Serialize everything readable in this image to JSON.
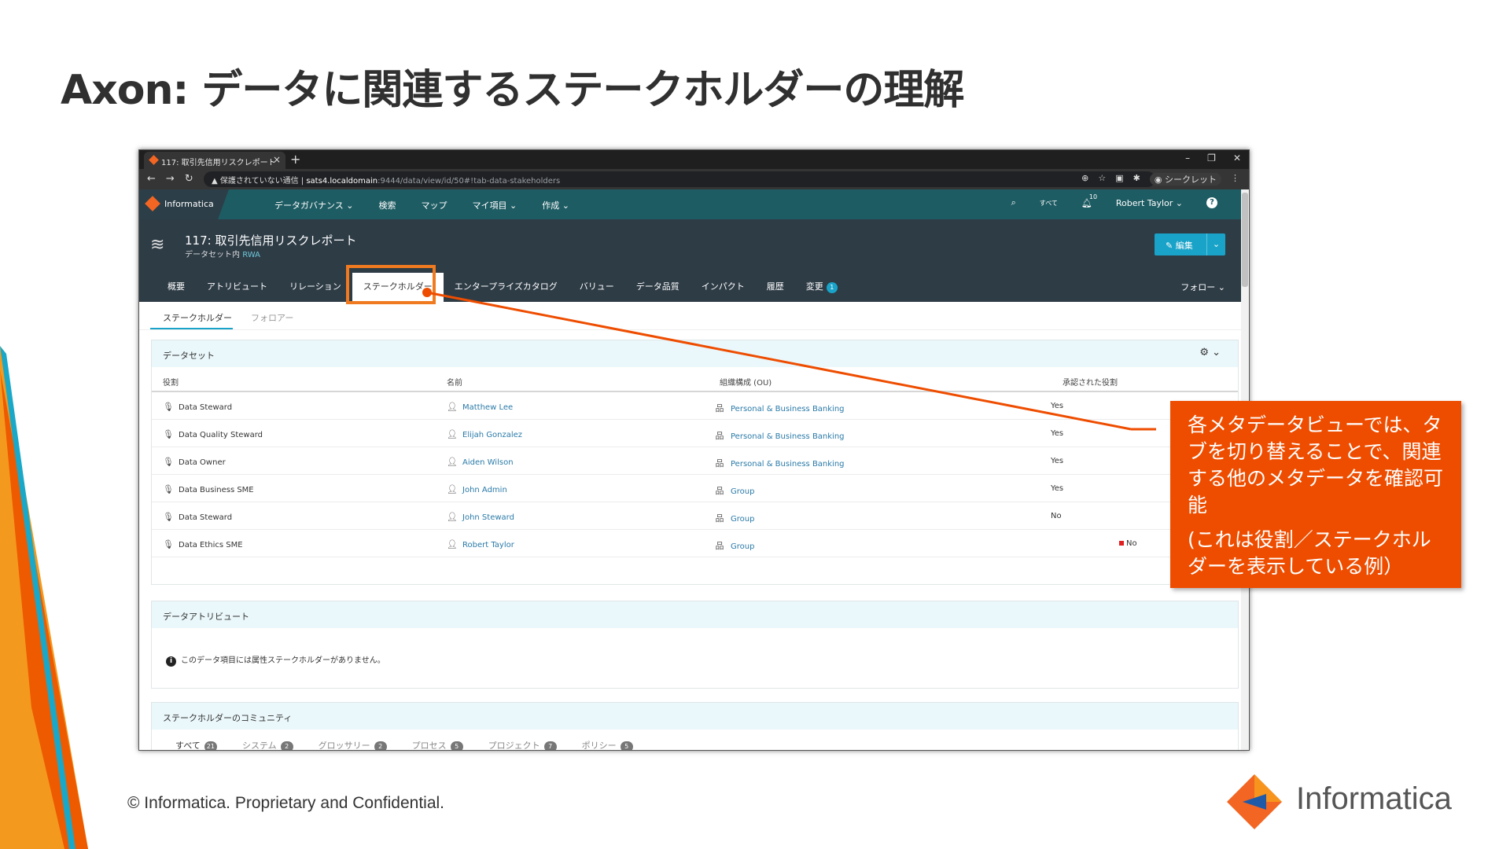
{
  "slide": {
    "title": "Axon: データに関連するステークホルダーの理解",
    "copyright": "© Informatica. Proprietary and Confidential.",
    "logo_text": "Informatica"
  },
  "browser": {
    "tab_title": "117: 取引先信用リスクレポート",
    "new_tab": "+",
    "insecure_label": "保護されていない通信",
    "url_host": "sats4.localdomain",
    "url_path": ":9444/data/view/id/50#!tab-data-stakeholders",
    "incognito_label": "シークレット"
  },
  "app_nav": {
    "logo": "Informatica",
    "items": [
      {
        "label": "データガバナンス ⌄"
      },
      {
        "label": "検索"
      },
      {
        "label": "マップ"
      },
      {
        "label": "マイ項目 ⌄"
      },
      {
        "label": "作成 ⌄"
      }
    ],
    "all_label": "すべて",
    "notification_count": "10",
    "user": "Robert Taylor ⌄"
  },
  "asset": {
    "title": "117: 取引先信用リスクレポート",
    "subtitle_prefix": "データセット内",
    "subtitle_link": "RWA",
    "edit_label": "編集",
    "tabs": [
      {
        "label": "概要"
      },
      {
        "label": "アトリビュート"
      },
      {
        "label": "リレーション"
      },
      {
        "label": "ステークホルダー"
      },
      {
        "label": "エンタープライズカタログ"
      },
      {
        "label": "バリュー"
      },
      {
        "label": "データ品質"
      },
      {
        "label": "インパクト"
      },
      {
        "label": "履歴"
      },
      {
        "label": "変更"
      }
    ],
    "change_count": "1",
    "follow_label": "フォロー ⌄"
  },
  "sub_tabs": {
    "stakeholders": "ステークホルダー",
    "followers": "フォロアー"
  },
  "dataset_panel": {
    "title": "データセット",
    "columns": [
      "役割",
      "名前",
      "組織構成 (OU)",
      "承認された役割"
    ],
    "rows": [
      {
        "role": "Data Steward",
        "name": "Matthew Lee",
        "ou": "Personal & Business Banking",
        "approved": "Yes",
        "flag": false
      },
      {
        "role": "Data Quality Steward",
        "name": "Elijah Gonzalez",
        "ou": "Personal & Business Banking",
        "approved": "Yes",
        "flag": false
      },
      {
        "role": "Data Owner",
        "name": "Aiden Wilson",
        "ou": "Personal & Business Banking",
        "approved": "Yes",
        "flag": false
      },
      {
        "role": "Data Business SME",
        "name": "John Admin",
        "ou": "Group",
        "approved": "Yes",
        "flag": false
      },
      {
        "role": "Data Steward",
        "name": "John Steward",
        "ou": "Group",
        "approved": "No",
        "flag": false
      },
      {
        "role": "Data Ethics SME",
        "name": "Robert Taylor",
        "ou": "Group",
        "approved": "No",
        "flag": true
      }
    ]
  },
  "attribute_panel": {
    "title": "データアトリビュート",
    "info": "このデータ項目には属性ステークホルダーがありません。"
  },
  "community_panel": {
    "title": "ステークホルダーのコミュニティ",
    "tabs": [
      {
        "label": "すべて",
        "count": "21"
      },
      {
        "label": "システム",
        "count": "2"
      },
      {
        "label": "グロッサリー",
        "count": "2"
      },
      {
        "label": "プロセス",
        "count": "5"
      },
      {
        "label": "プロジェクト",
        "count": "7"
      },
      {
        "label": "ポリシー",
        "count": "5"
      }
    ]
  },
  "callout": {
    "line1": "各メタデータビューでは、タブを切り替えることで、関連する他のメタデータを確認可能",
    "line2": "(これは役割／ステークホルダーを表示している例）"
  },
  "colors": {
    "accent_orange": "#f07a1f",
    "callout_bg": "#ee4d00",
    "app_teal": "#1e5c63",
    "header_dark": "#2e3c46",
    "link_blue": "#2a7aa8"
  }
}
